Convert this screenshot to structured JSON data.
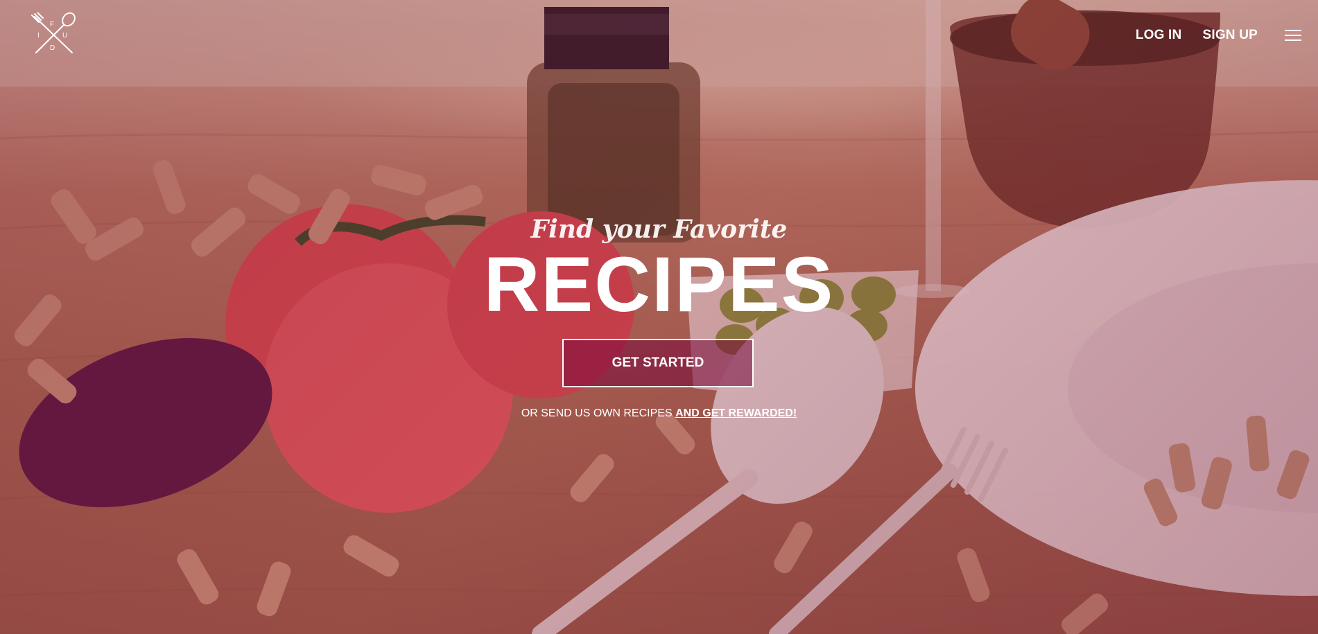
{
  "brand": {
    "logo_letters": [
      "F",
      "I",
      "U",
      "D"
    ],
    "icon": "fork-spoon-cross-icon"
  },
  "nav": {
    "login_label": "LOG IN",
    "signup_label": "SIGN UP",
    "menu_icon": "hamburger-icon"
  },
  "hero": {
    "kicker": "Find your Favorite",
    "headline": "RECIPES",
    "cta_label": "GET STARTED",
    "sub_text": "OR SEND US OWN RECIPES",
    "sub_link": "AND GET REWARDED!"
  },
  "colors": {
    "overlay": "#7a1440",
    "text": "#ffffff"
  }
}
